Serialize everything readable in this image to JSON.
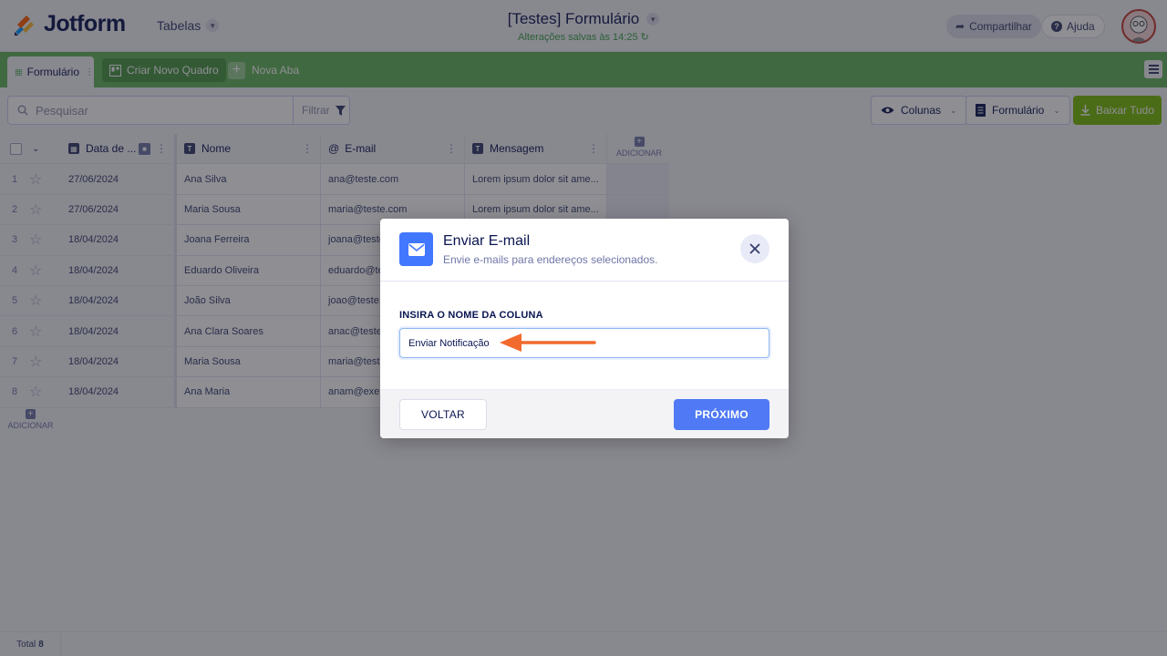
{
  "app": {
    "brand": "Jotform",
    "tables_menu": "Tabelas",
    "form_title": "[Testes] Formulário",
    "saved_status": "Alterações salvas às 14:25",
    "share_label": "Compartilhar",
    "help_label": "Ajuda"
  },
  "tabs": {
    "active": "Formulário",
    "board": "Criar Novo Quadro",
    "new_tab": "Nova Aba"
  },
  "toolbar": {
    "search_placeholder": "Pesquisar",
    "filter_label": "Filtrar",
    "columns_label": "Colunas",
    "form_label": "Formulário",
    "download_label": "Baixar Tudo"
  },
  "table": {
    "headers": {
      "date": "Data de ...",
      "name": "Nome",
      "email": "E-mail",
      "message": "Mensagem",
      "add_column": "ADICIONAR"
    },
    "rows": [
      {
        "n": "1",
        "date": "27/06/2024",
        "name": "Ana Silva",
        "email": "ana@teste.com",
        "message": "Lorem ipsum dolor sit ame..."
      },
      {
        "n": "2",
        "date": "27/06/2024",
        "name": "Maria Sousa",
        "email": "maria@teste.com",
        "message": "Lorem ipsum dolor sit ame..."
      },
      {
        "n": "3",
        "date": "18/04/2024",
        "name": "Joana Ferreira",
        "email": "joana@teste",
        "message": ""
      },
      {
        "n": "4",
        "date": "18/04/2024",
        "name": "Eduardo Oliveira",
        "email": "eduardo@te",
        "message": ""
      },
      {
        "n": "5",
        "date": "18/04/2024",
        "name": "João Silva",
        "email": "joao@teste.",
        "message": ""
      },
      {
        "n": "6",
        "date": "18/04/2024",
        "name": "Ana Clara Soares",
        "email": "anac@teste",
        "message": ""
      },
      {
        "n": "7",
        "date": "18/04/2024",
        "name": "Maria Sousa",
        "email": "maria@teste",
        "message": ""
      },
      {
        "n": "8",
        "date": "18/04/2024",
        "name": "Ana Maria",
        "email": "anam@exem",
        "message": ""
      }
    ],
    "add_row": "ADICIONAR",
    "total_label": "Total",
    "total_count": "8"
  },
  "modal": {
    "title": "Enviar E-mail",
    "subtitle": "Envie e-mails para endereços selecionados.",
    "field_label": "INSIRA O NOME DA COLUNA",
    "field_value": "Enviar Notificação",
    "back_label": "VOLTAR",
    "next_label": "PRÓXIMO"
  },
  "colors": {
    "tab_bar": "#64b55b",
    "primary": "#4f79f5",
    "download": "#78bb07",
    "annotation_arrow": "#f26a2e"
  }
}
